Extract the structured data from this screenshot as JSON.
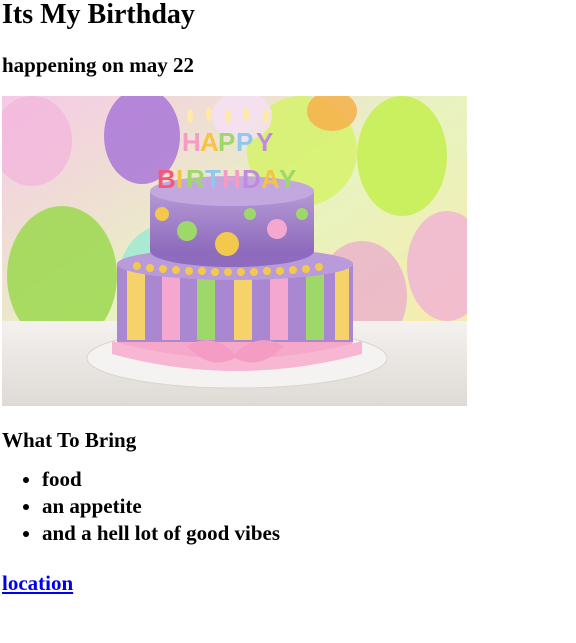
{
  "page": {
    "title": "Its My Birthday",
    "subtitle": "happening on may 22"
  },
  "image": {
    "subject": "birthday cake with candles spelling the text below",
    "candle_text": "HAPPY BIRTHDAY"
  },
  "bring": {
    "heading": "What To Bring",
    "items": [
      "food",
      "an appetite",
      "and a hell lot of good vibes"
    ]
  },
  "location": {
    "label": "location"
  },
  "colors": {
    "link": "#0000ee",
    "text": "#000000",
    "background": "#ffffff"
  }
}
